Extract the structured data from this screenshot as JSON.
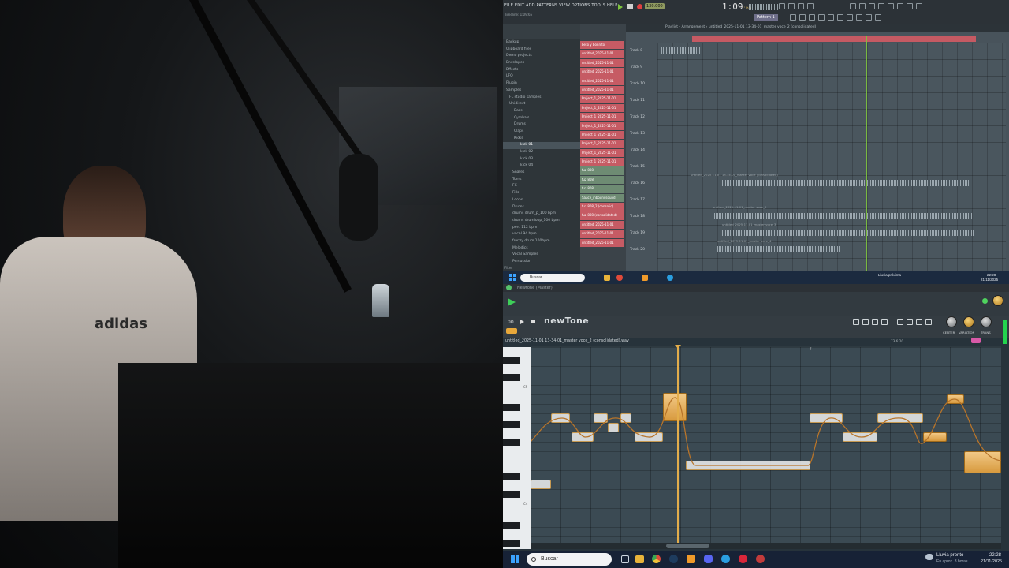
{
  "fl": {
    "menu": "FILE  EDIT  ADD  PATTERNS  VIEW  OPTIONS  TOOLS  HELP",
    "hint": "Timeline: 1:09:65",
    "time": "1:09",
    "time_frac": ":65",
    "tempo": "130.000",
    "pattern": "Pattern 1",
    "playlist_title": "Playlist - Arrangement › untitled_2025-11-01 13-34-01_master voce_2 (consolidated)",
    "browser_items": [
      "Backup",
      "Clipboard files",
      "Demo projects",
      "Envelopes",
      "Effects",
      "LFO",
      "Plugin",
      "Samples",
      "FL studio samples",
      "Unidirect",
      "Bass",
      "Cymbals",
      "Drums",
      "Claps",
      "Kicks",
      "kick 01",
      "kick 02",
      "kick 03",
      "kick 04",
      "Snares",
      "Toms",
      "FX",
      "Fills",
      "Loops",
      "Drums",
      "drums drum_p_100 bpm",
      "drums drumloop_100 bpm",
      "perc 112 bpm",
      "vocal 94 bpm",
      "frenzy drum 100bpm",
      "Melodics",
      "Vocal Samples",
      "Percussion"
    ],
    "channels": [
      "beto y bonnito",
      "untitled_2025-11-01",
      "untitled_2025-11-01",
      "untitled_2025-11-01",
      "untitled_2025-11-01",
      "untitled_2025-11-01",
      "Project_1_2025-11-01",
      "Project_1_2025-11-01",
      "Project_1_2025-11-01",
      "Project_1_2025-11-01",
      "Project_1_2025-11-01",
      "Project_1_2025-11-01",
      "Project_1_2025-11-01",
      "Project_1_2025-11-01",
      "fuz 808",
      "fuz 808",
      "fuz 808",
      "Sauce_inboundsound",
      "fuz 808_2 (consolid)",
      "fuz 808 (consolidated)",
      "untitled_2025-11-01",
      "untitled_2025-11-01",
      "untitled_2025-11-01"
    ],
    "tracks": [
      "Track 8",
      "Track 9",
      "Track 10",
      "Track 11",
      "Track 12",
      "Track 13",
      "Track 14",
      "Track 15",
      "Track 16",
      "Track 17",
      "Track 18",
      "Track 19",
      "Track 20"
    ],
    "clip_labels": [
      "untitled_2025-11-01 13-34-01_master voce (consolidated)",
      "untitled_2025-11-01_master voce_2",
      "untitled_2025-11-01_master voce_3",
      "untitled_2025-11-01_master voce_4"
    ],
    "browser_search": "Filter"
  },
  "taskbar_top": {
    "search": "Buscar",
    "weather": "Lluvia próxima",
    "weather_sub": "En aprox. 3 horas",
    "lang": "ESP LAA",
    "clock": "22:28",
    "date": "21/11/2025"
  },
  "newtone": {
    "window_title": "Newtone (Master)",
    "logo": "newTone",
    "file": "untitled_2025-11-01 13-34-01_master voce_2 (consolidated).wav",
    "info": "73.6:20",
    "knob_labels": [
      "CENTER",
      "VARIATION",
      "TRANS"
    ],
    "octaves": [
      "C5",
      "C4"
    ],
    "bar_marker": "7"
  },
  "taskbar_bottom": {
    "search": "Buscar",
    "weather": "Lluvia pronto",
    "weather_sub": "En aprox. 3 horas",
    "clock": "22:28",
    "date": "21/11/2025"
  },
  "colors": {
    "accent_fl": "#c65b64",
    "playhead_fl": "#7ec43e",
    "note_highlight": "#e3ad4b",
    "taskbar": "#172236"
  }
}
